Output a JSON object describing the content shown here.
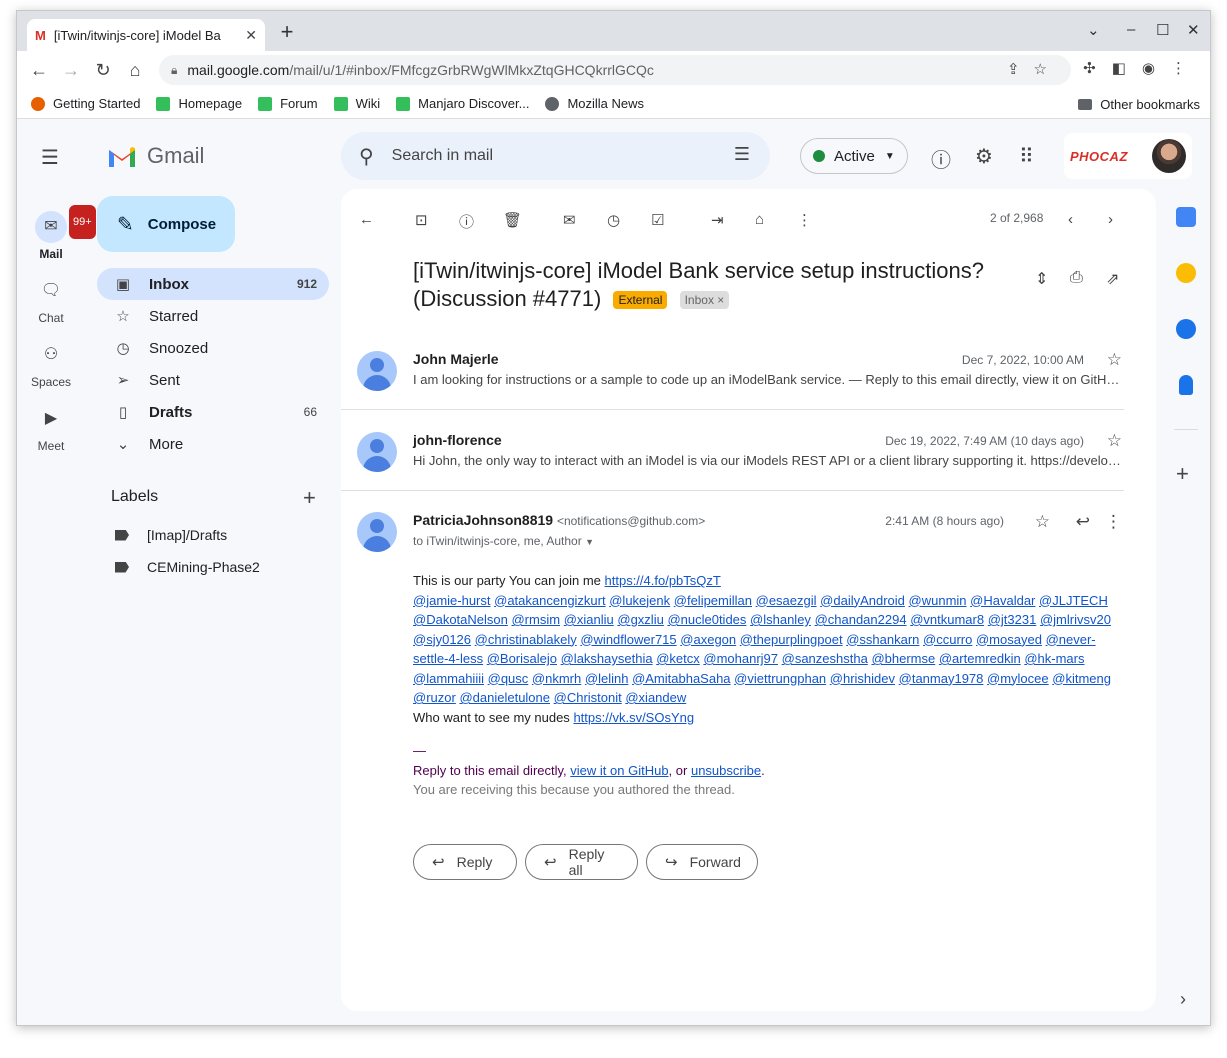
{
  "browser": {
    "tab_title": "[iTwin/itwinjs-core] iModel Ba",
    "url_host": "mail.google.com",
    "url_path": "/mail/u/1/#inbox/FMfcgzGrbRWgWlMkxZtqGHCQkrrlGCQc",
    "bookmarks": [
      {
        "label": "Getting Started",
        "color": "#e66000"
      },
      {
        "label": "Homepage",
        "color": "#35bf5c"
      },
      {
        "label": "Forum",
        "color": "#35bf5c"
      },
      {
        "label": "Wiki",
        "color": "#35bf5c"
      },
      {
        "label": "Manjaro Discover...",
        "color": "#35bf5c"
      },
      {
        "label": "Mozilla News",
        "color": "#5f6368"
      }
    ],
    "other_bookmarks": "Other bookmarks"
  },
  "gmail": {
    "logo": "Gmail",
    "rail": {
      "mail": "Mail",
      "mail_badge": "99+",
      "chat": "Chat",
      "spaces": "Spaces",
      "meet": "Meet"
    },
    "compose": "Compose",
    "nav": [
      {
        "label": "Inbox",
        "count": "912",
        "icon": "inbox-icon"
      },
      {
        "label": "Starred",
        "count": "",
        "icon": "star-icon"
      },
      {
        "label": "Snoozed",
        "count": "",
        "icon": "clock-icon"
      },
      {
        "label": "Sent",
        "count": "",
        "icon": "send-icon"
      },
      {
        "label": "Drafts",
        "count": "66",
        "icon": "draft-icon"
      },
      {
        "label": "More",
        "count": "",
        "icon": "chevron-down-icon"
      }
    ],
    "labels_title": "Labels",
    "labels": [
      "[Imap]/Drafts",
      "CEMining-Phase2"
    ],
    "search_placeholder": "Search in mail",
    "status": "Active",
    "account_brand": "PHOCAZ"
  },
  "thread": {
    "pager": "2 of 2,968",
    "subject": "[iTwin/itwinjs-core] iModel Bank service setup instructions? (Discussion #4771)",
    "tag_external": "External",
    "tag_inbox": "Inbox",
    "messages": [
      {
        "sender": "John Majerle",
        "date": "Dec 7, 2022, 10:00 AM",
        "snippet": "I am looking for instructions or a sample to code up an iModelBank service. — Reply to this email directly, view it on GitH…"
      },
      {
        "sender": "john-florence",
        "date": "Dec 19, 2022, 7:49 AM (10 days ago)",
        "snippet": "Hi John, the only way to interact with an iModel is via our iModels REST API or a client library supporting it. https://develo…"
      }
    ],
    "open": {
      "sender": "PatriciaJohnson8819",
      "email": "<notifications@github.com>",
      "date": "2:41 AM (8 hours ago)",
      "to": "to iTwin/itwinjs-core, me, Author",
      "intro": "This is our party You can join me",
      "link1": "https://4.fo/pbTsQzT",
      "mentions": [
        "@jamie-hurst",
        "@atakancengizkurt",
        "@lukejenk",
        "@felipemillan",
        "@esaezgil",
        "@dailyAndroid",
        "@wunmin",
        "@Havaldar",
        "@JLJTECH",
        "@DakotaNelson",
        "@rmsim",
        "@xianliu",
        "@gxzliu",
        "@nucle0tides",
        "@lshanley",
        "@chandan2294",
        "@vntkumar8",
        "@jt3231",
        "@jmlrivsv20",
        "@sjy0126",
        "@christinablakely",
        "@windflower715",
        "@axegon",
        "@thepurplingpoet",
        "@sshankarn",
        "@ccurro",
        "@mosayed",
        "@never-settle-4-less",
        "@Borisalejo",
        "@lakshaysethia",
        "@ketcx",
        "@mohanrj97",
        "@sanzeshstha",
        "@bhermse",
        "@artemredkin",
        "@hk-mars",
        "@lammahiiii",
        "@qusc",
        "@nkmrh",
        "@lelinh",
        "@AmitabhaSaha",
        "@viettrungphan",
        "@hrishidev",
        "@tanmay1978",
        "@mylocee",
        "@kitmeng",
        "@ruzor",
        "@danieletulone",
        "@Christonit",
        "@xiandew"
      ],
      "line2": "Who want to see my nudes",
      "link2": "https://vk.sv/SOsYng",
      "dash": "—",
      "footer_prefix": "Reply to this email directly,",
      "footer_link1": "view it on GitHub",
      "footer_mid": ", or",
      "footer_link2": "unsubscribe",
      "footer_end": ".",
      "footer2": "You are receiving this because you authored the thread."
    },
    "actions": {
      "reply": "Reply",
      "reply_all": "Reply all",
      "forward": "Forward"
    }
  }
}
